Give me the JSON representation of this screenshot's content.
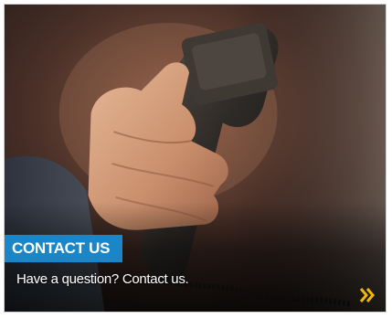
{
  "card": {
    "badge_label": "CONTACT US",
    "subtitle": "Have a question? Contact us.",
    "image_subject": "hand-holding-telephone-receiver",
    "chevron_icon": "double-chevron-right-icon"
  },
  "colors": {
    "badge_bg": "#1a86c7",
    "chevron": "#f2b705",
    "text": "#ffffff"
  }
}
